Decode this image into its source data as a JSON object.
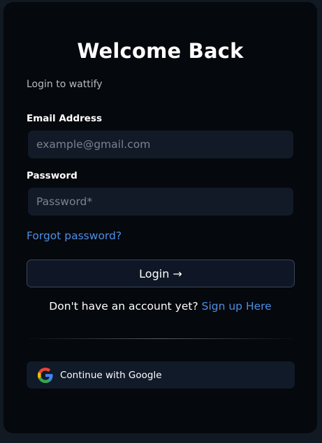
{
  "card": {
    "title": "Welcome Back",
    "subtitle": "Login to wattify"
  },
  "form": {
    "email_label": "Email Address",
    "email_placeholder": "example@gmail.com",
    "password_label": "Password",
    "password_placeholder": "Password*",
    "forgot_link": "Forgot password?",
    "login_button": "Login →"
  },
  "signup": {
    "prompt": "Don't have an account yet?",
    "link": "Sign up Here"
  },
  "social": {
    "google_button": "Continue with Google",
    "icon": "google-icon"
  },
  "colors": {
    "accent": "#4f8ee6",
    "card_bg": "#05080c",
    "input_bg": "#121a28",
    "page_bg": "#111923"
  }
}
